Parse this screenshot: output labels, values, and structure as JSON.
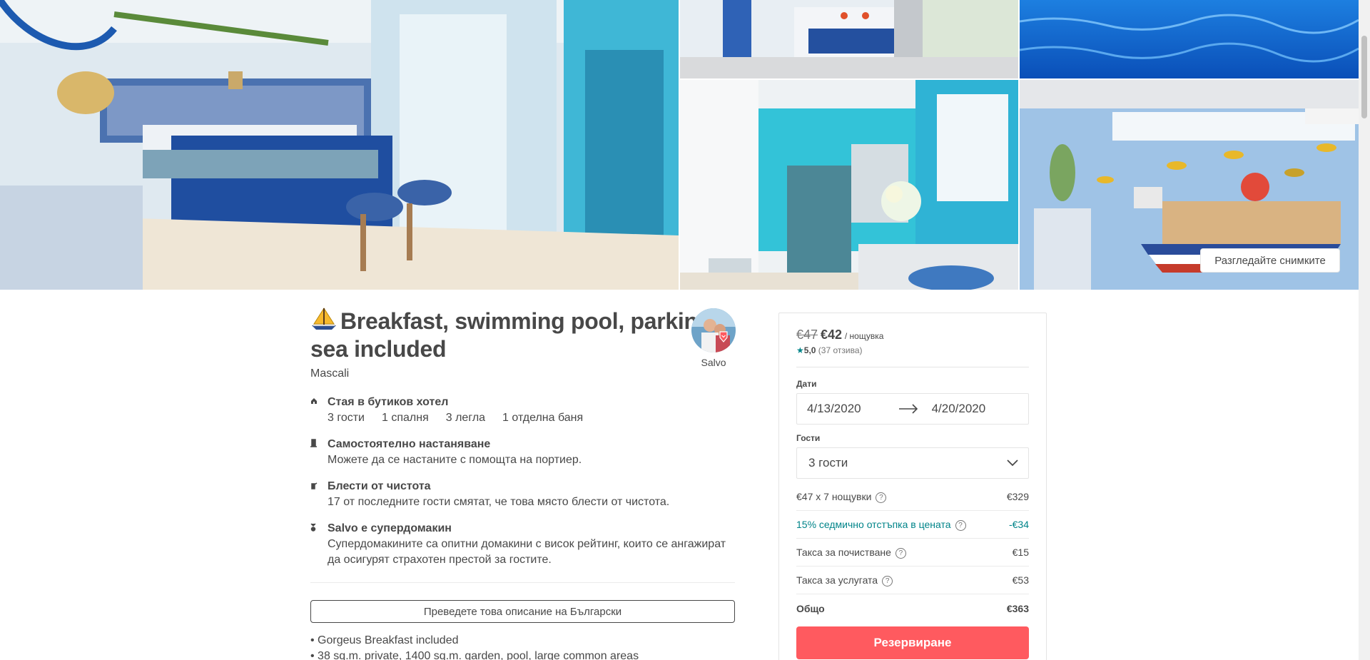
{
  "gallery": {
    "explore_button": "Разгледайте снимките",
    "photos": [
      "bedroom",
      "terrace",
      "pool",
      "bathroom",
      "breakfast-room"
    ]
  },
  "listing": {
    "title": "Breakfast, swimming pool, parking, sea included",
    "location": "Mascali",
    "host_name": "Salvo",
    "features": [
      {
        "icon": "home-icon",
        "title": "Стая в бутиков хотел",
        "meta": [
          "3 гости",
          "1 спалня",
          "3 легла",
          "1 отделна баня"
        ]
      },
      {
        "icon": "door-icon",
        "title": "Самостоятелно настаняване",
        "desc": "Можете да се настаните с помощта на портиер."
      },
      {
        "icon": "sparkle-icon",
        "title": "Блести от чистота",
        "desc": "17 от последните гости смятат, че това място блести от чистота."
      },
      {
        "icon": "medal-icon",
        "title": "Salvo е супердомакин",
        "desc": "Супердомакините са опитни домакини с висок рейтинг, които се ангажират да осигурят страхотен престой за гостите."
      }
    ],
    "translate_button": "Преведете това описание на Български",
    "description_lines": [
      "• Gorgeus Breakfast included",
      "• 38 sq.m. private, 1400 sq.m. garden, pool, large common areas"
    ]
  },
  "booking": {
    "price_old": "€47",
    "price_new": "€42",
    "price_unit": "/ нощувка",
    "rating_score": "5,0",
    "rating_count": "(37 отзива)",
    "dates_label": "Дати",
    "check_in": "4/13/2020",
    "check_out": "4/20/2020",
    "guests_label": "Гости",
    "guests_value": "3 гости",
    "fees": [
      {
        "label": "€47 x 7 нощувки",
        "value": "€329",
        "help": true
      },
      {
        "label": "15% седмично отстъпка в цената",
        "value": "-€34",
        "help": true
      },
      {
        "label": "Такса за почистване",
        "value": "€15",
        "help": true
      },
      {
        "label": "Такса за услугата",
        "value": "€53",
        "help": true
      }
    ],
    "total_label": "Общо",
    "total_value": "€363",
    "reserve_button": "Резервиране",
    "accent_color": "#ff5a5f",
    "teal_color": "#008489"
  }
}
